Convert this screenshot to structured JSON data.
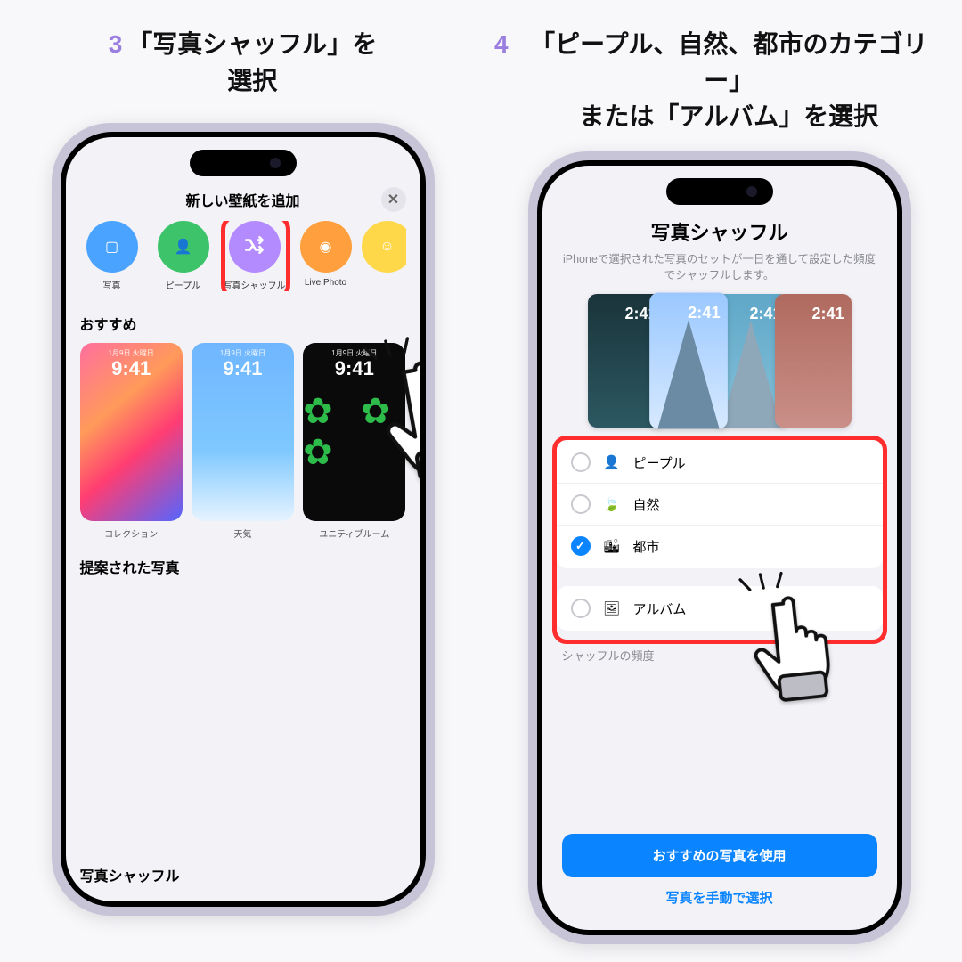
{
  "steps": {
    "s3": {
      "num": "3",
      "text": "「写真シャッフル」を\n選択"
    },
    "s4": {
      "num": "4",
      "text": "「ピープル、自然、都市のカテゴリー」\nまたは「アルバム」を選択"
    }
  },
  "screen1": {
    "title": "新しい壁紙を追加",
    "close": "✕",
    "categories": [
      {
        "label": "写真",
        "color": "c-blue",
        "icon": "🖼"
      },
      {
        "label": "ピープル",
        "color": "c-green",
        "icon": "👤"
      },
      {
        "label": "写真シャッフル",
        "color": "c-purple",
        "icon": "✕→"
      },
      {
        "label": "Live Photo",
        "color": "c-orange",
        "icon": "◎"
      },
      {
        "label": "",
        "color": "c-yellow",
        "icon": "☺"
      }
    ],
    "sec_reco": "おすすめ",
    "sample_date": "1月9日 火曜日",
    "sample_time": "9:41",
    "wallpapers": [
      {
        "label": "コレクション"
      },
      {
        "label": "天気"
      },
      {
        "label": "ユニティブルーム"
      }
    ],
    "sec_photos": "提案された写真",
    "bottom": "写真シャッフル"
  },
  "screen2": {
    "title": "写真シャッフル",
    "desc": "iPhoneで選択された写真のセットが一日を通して設定した頻度でシャッフルします。",
    "fan_time": "2:41",
    "options": [
      {
        "label": "ピープル",
        "icon": "👤",
        "checked": false
      },
      {
        "label": "自然",
        "icon": "🍃",
        "checked": false
      },
      {
        "label": "都市",
        "icon": "🏙",
        "checked": true
      }
    ],
    "album": {
      "label": "アルバム",
      "icon": "🖼",
      "checked": false
    },
    "freq_label": "シャッフルの頻度",
    "primary": "おすすめの写真を使用",
    "link": "写真を手動で選択"
  }
}
